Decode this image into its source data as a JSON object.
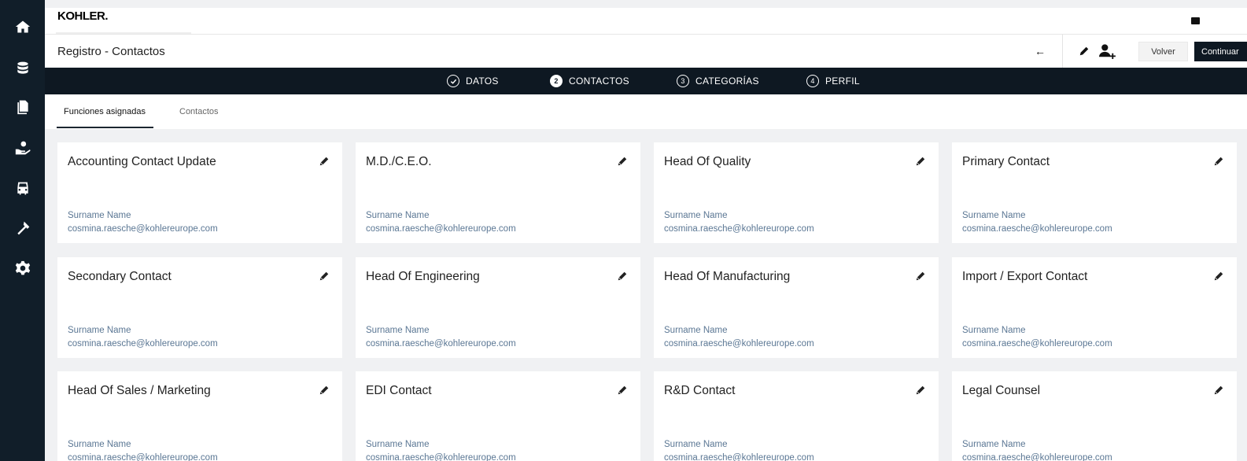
{
  "brand": {
    "logo_text": "KOHLER."
  },
  "header": {
    "title": "Registro - Contactos",
    "back_arrow": "←",
    "volver_label": "Volver",
    "continuar_label": "Continuar"
  },
  "stepper": {
    "steps": [
      {
        "number": "",
        "label": "DATOS",
        "state": "done"
      },
      {
        "number": "2",
        "label": "CONTACTOS",
        "state": "active"
      },
      {
        "number": "3",
        "label": "CATEGORÍAS",
        "state": "pending"
      },
      {
        "number": "4",
        "label": "PERFIL",
        "state": "pending"
      }
    ]
  },
  "tabs": [
    {
      "label": "Funciones asignadas",
      "active": true
    },
    {
      "label": "Contactos",
      "active": false
    }
  ],
  "cards": [
    {
      "title": "Accounting Contact Update",
      "name": "Surname Name",
      "email": "cosmina.raesche@kohlereurope.com"
    },
    {
      "title": "M.D./C.E.O.",
      "name": "Surname Name",
      "email": "cosmina.raesche@kohlereurope.com"
    },
    {
      "title": "Head Of Quality",
      "name": "Surname Name",
      "email": "cosmina.raesche@kohlereurope.com"
    },
    {
      "title": "Primary Contact",
      "name": "Surname Name",
      "email": "cosmina.raesche@kohlereurope.com"
    },
    {
      "title": "Secondary Contact",
      "name": "Surname Name",
      "email": "cosmina.raesche@kohlereurope.com"
    },
    {
      "title": "Head Of Engineering",
      "name": "Surname Name",
      "email": "cosmina.raesche@kohlereurope.com"
    },
    {
      "title": "Head Of Manufacturing",
      "name": "Surname Name",
      "email": "cosmina.raesche@kohlereurope.com"
    },
    {
      "title": "Import / Export Contact",
      "name": "Surname Name",
      "email": "cosmina.raesche@kohlereurope.com"
    },
    {
      "title": "Head Of Sales / Marketing",
      "name": "Surname Name",
      "email": "cosmina.raesche@kohlereurope.com"
    },
    {
      "title": "EDI Contact",
      "name": "Surname Name",
      "email": "cosmina.raesche@kohlereurope.com"
    },
    {
      "title": "R&D Contact",
      "name": "Surname Name",
      "email": "cosmina.raesche@kohlereurope.com"
    },
    {
      "title": "Legal Counsel",
      "name": "Surname Name",
      "email": "cosmina.raesche@kohlereurope.com"
    }
  ],
  "sidebar": {
    "icons": [
      "home-icon",
      "database-icon",
      "documents-icon",
      "support-hand-icon",
      "vehicle-icon",
      "tools-icon",
      "settings-gear-icon"
    ]
  },
  "colors": {
    "sidebar_bg": "#111e29",
    "stepper_bg": "#0e1822",
    "card_secondary_text": "#5b7794",
    "page_bg": "#f0f1f3"
  }
}
